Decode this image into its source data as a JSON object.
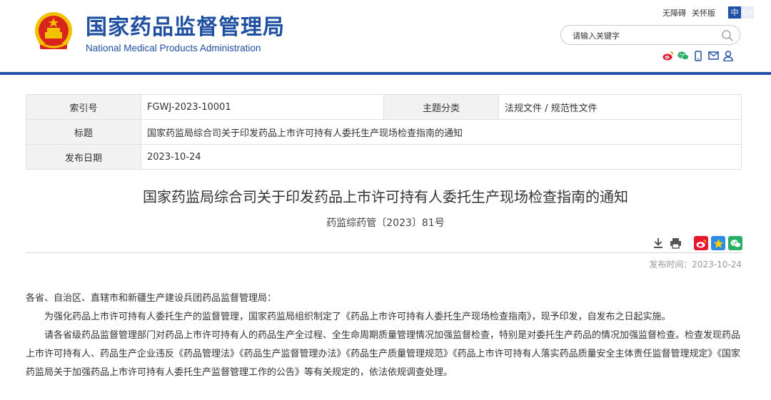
{
  "header": {
    "site_name_cn": "国家药品监督管理局",
    "site_name_en": "National Medical Products Administration",
    "accessibility_link": "无障碍",
    "care_mode_link": "关怀版",
    "lang_zh": "中",
    "lang_en": "En",
    "search_placeholder": "请输入关键字",
    "colors": {
      "brand_blue": "#2151a6",
      "weibo_red": "#e6162d",
      "wechat_green": "#2aae67"
    },
    "social_icons": [
      "weibo-icon",
      "wechat-icon",
      "mobile-icon",
      "email-icon",
      "user-icon"
    ]
  },
  "meta": {
    "index_label": "索引号",
    "index_value": "FGWJ-2023-10001",
    "category_label": "主题分类",
    "category_value": "法规文件 / 规范性文件",
    "title_label": "标题",
    "title_value": "国家药监局综合司关于印发药品上市许可持有人委托生产现场检查指南的通知",
    "date_label": "发布日期",
    "date_value": "2023-10-24"
  },
  "article": {
    "title": "国家药监局综合司关于印发药品上市许可持有人委托生产现场检查指南的通知",
    "doc_number": "药监综药管〔2023〕81号",
    "tool_icons": [
      "download-icon",
      "print-icon",
      "weibo-share-icon",
      "qzone-share-icon",
      "wechat-share-icon"
    ],
    "publish_date": "发布时间：2023-10-24",
    "salutation": "各省、自治区、直辖市和新疆生产建设兵团药品监督管理局：",
    "paragraph_1": "为强化药品上市许可持有人委托生产的监督管理，国家药监局组织制定了《药品上市许可持有人委托生产现场检查指南》，现予印发，自发布之日起实施。",
    "paragraph_2": "请各省级药品监督管理部门对药品上市许可持有人的药品生产全过程、全生命周期质量管理情况加强监督检查，特别是对委托生产药品的情况加强监督检查。检查发现药品上市许可持有人、药品生产企业违反《药品管理法》《药品生产监督管理办法》《药品生产质量管理规范》《药品上市许可持有人落实药品质量安全主体责任监督管理规定》《国家药监局关于加强药品上市许可持有人委托生产监督管理工作的公告》等有关规定的，依法依规调查处理。"
  }
}
